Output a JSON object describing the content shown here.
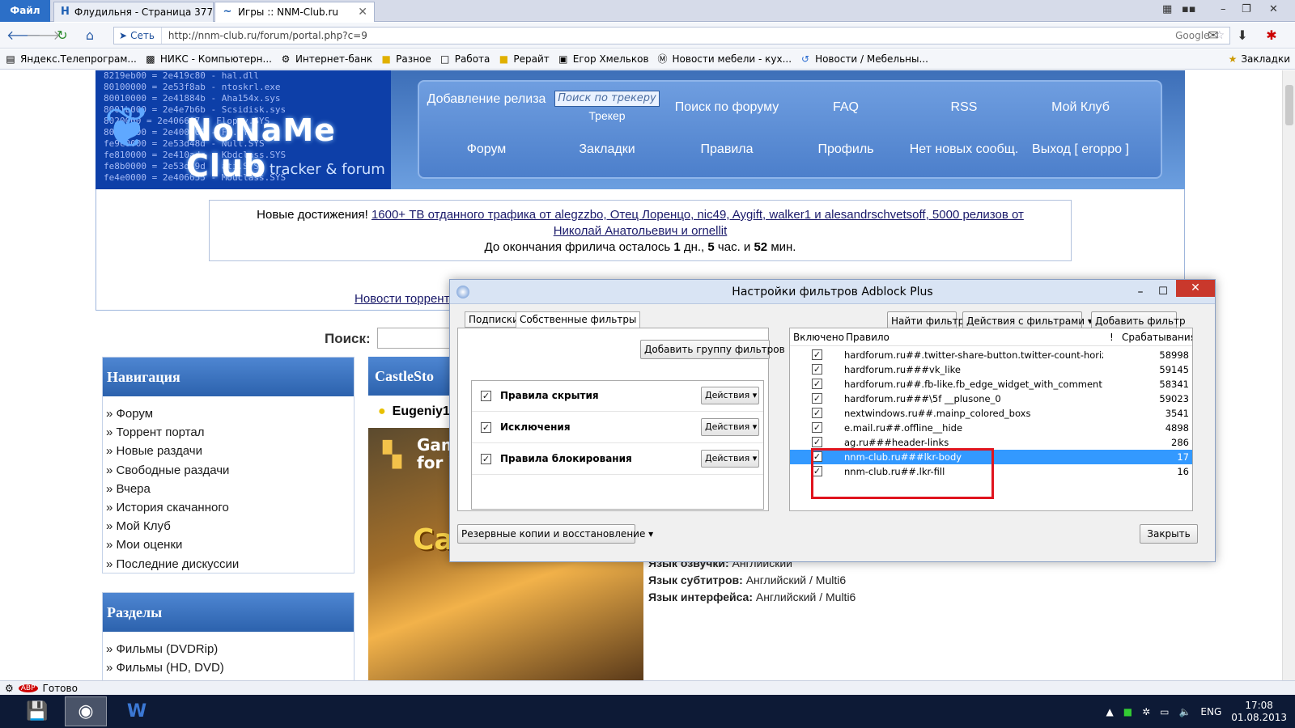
{
  "browser": {
    "file_menu": "Файл",
    "tabs": [
      {
        "label": "Флудильня - Страница 377 - ...",
        "favicon": "H"
      },
      {
        "label": "Игры :: NNM-Club.ru",
        "favicon": "~"
      }
    ],
    "address": {
      "network_label": "Сеть",
      "url": "http://nnm-club.ru/forum/portal.php?c=9",
      "search_engine": "Google"
    },
    "bookmarks": [
      {
        "label": "Яндекс.Телепрограм...",
        "icon": "page-icon"
      },
      {
        "label": "НИКС - Компьютерн...",
        "icon": "nix-icon"
      },
      {
        "label": "Интернет-банк",
        "icon": "gear-icon"
      },
      {
        "label": "Разное",
        "icon": "folder-icon"
      },
      {
        "label": "Работа",
        "icon": "page-icon"
      },
      {
        "label": "Рерайт",
        "icon": "folder-icon"
      },
      {
        "label": "Егор Хмельков",
        "icon": "image-icon"
      },
      {
        "label": "Новости мебели - кух...",
        "icon": "m-icon"
      },
      {
        "label": "Новости / Мебельны...",
        "icon": "loop-icon"
      }
    ],
    "bookmarks_menu": "Закладки",
    "status": "Готово"
  },
  "site": {
    "logo_title": "NoNaMe Club",
    "logo_subtitle": "tracker & forum",
    "logo_code": "8219eb00 = 2e419c80 - hal.dll\n80100000 = 2e53f8ab - ntoskrl.exe\n80010000 = 2e41884b - Aha154x.sys\n8001b000 = 2e4e7b6b - Scsidisk.sys\n8020000 = 2e406607 - Floppy.SYS\n8021d000 = 2e400000 - Fs.SYS\nfe9c0000 = 2e53d48d - Null.SYS\nfe810000 = 2e410adc - Kbdclass.SYS\nfe8b0000 = 2e53d49d - ati.SYS\nfe4e0000 = 2e406655 - Mouclass.SYS",
    "nav": {
      "add_release": "Добавление релиза",
      "tracker_search_placeholder": "Поиск по трекеру",
      "tracker": "Трекер",
      "forum_search": "Поиск по форуму",
      "faq": "FAQ",
      "rss": "RSS",
      "my_club": "Мой Клуб",
      "forum": "Форум",
      "bookmarks": "Закладки",
      "rules": "Правила",
      "profile": "Профиль",
      "no_new": "Нет новых сообщ.",
      "logout": "Выход [ erорро ]"
    },
    "announce": {
      "prefix": "Новые достижения!",
      "link": "1600+ ТВ отданного трафика от alegzzbo, Отец Лоренцо, nic49, Aygift, walker1 и alesandrschvetsoff, 5000 релизов от",
      "link2": "Николай Анатольевич и ornellit",
      "timer_prefix": "До окончания фрилича осталось",
      "days": "1",
      "days_label": "дн.,",
      "hours": "5",
      "hours_label": "час. и",
      "minutes": "52",
      "minutes_label": "мин."
    },
    "news_link": "Новости торрент",
    "search_label": "Поиск:",
    "navigation": {
      "title": "Навигация",
      "items": [
        "» Форум",
        "» Торрент портал",
        "» Новые раздачи",
        "» Свободные раздачи",
        "» Вчера",
        "» История скачанного",
        "» Мой Клуб",
        "» Мои оценки",
        "» Последние дискуссии"
      ]
    },
    "sections": {
      "title": "Разделы",
      "items": [
        "» Фильмы (DVDRip)",
        "» Фильмы (HD, DVD)"
      ]
    },
    "castle": {
      "title": "CastleSto",
      "user": "Eugeniy1",
      "poster_top": "Gam\nfor W",
      "poster_title": "CastleStorm"
    },
    "details": [
      {
        "label": "Язык озвучки:",
        "value": "Английский"
      },
      {
        "label": "Язык субтитров:",
        "value": "Английский / Multi6"
      },
      {
        "label": "Язык интерфейса:",
        "value": "Английский / Multi6"
      }
    ]
  },
  "abp": {
    "title": "Настройки фильтров Adblock Plus",
    "tabs": [
      "Подписки",
      "Собственные фильтры"
    ],
    "add_group": "Добавить группу фильтров",
    "groups": [
      {
        "label": "Правила скрытия",
        "checked": true,
        "action": "Действия ▾"
      },
      {
        "label": "Исключения",
        "checked": true,
        "action": "Действия ▾"
      },
      {
        "label": "Правила блокирования",
        "checked": true,
        "action": "Действия ▾"
      }
    ],
    "find_filter": "Найти фильтр",
    "filter_actions": "Действия с фильтрами ▾",
    "add_filter": "Добавить фильтр",
    "columns": {
      "enabled": "Включено",
      "rule": "Правило",
      "bang": "!",
      "hits": "Срабатывания"
    },
    "filters": [
      {
        "rule": "hardforum.ru##.twitter-share-button.twitter-count-horiz...",
        "hits": "58998"
      },
      {
        "rule": "hardforum.ru###vk_like",
        "hits": "59145"
      },
      {
        "rule": "hardforum.ru##.fb-like.fb_edge_widget_with_comment.f...",
        "hits": "58341"
      },
      {
        "rule": "hardforum.ru###\\5f __plusone_0",
        "hits": "59023"
      },
      {
        "rule": "nextwindows.ru##.mainp_colored_boxs",
        "hits": "3541"
      },
      {
        "rule": "e.mail.ru##.offline__hide",
        "hits": "4898"
      },
      {
        "rule": "ag.ru###header-links",
        "hits": "286"
      },
      {
        "rule": "nnm-club.ru###lkr-body",
        "hits": "17"
      },
      {
        "rule": "nnm-club.ru##.lkr-fill",
        "hits": "16"
      }
    ],
    "backup": "Резервные копии и восстановление ▾",
    "close": "Закрыть"
  },
  "taskbar": {
    "lang": "ENG",
    "time": "17:08",
    "date": "01.08.2013"
  }
}
